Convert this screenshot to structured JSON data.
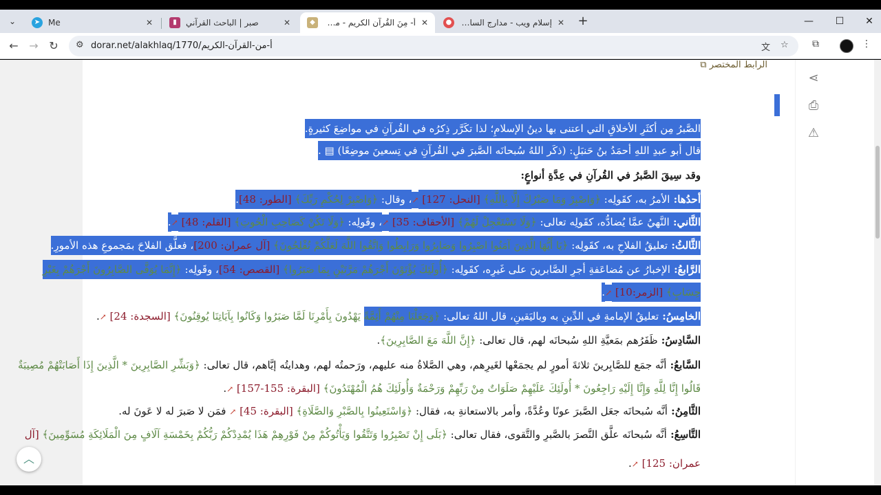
{
  "browser": {
    "tabs": [
      {
        "title": "Me",
        "active": false
      },
      {
        "title": "صبر | الباحث القرآني",
        "active": false
      },
      {
        "title": "أ- مِنَ القُرآنِ الكريمِ - موسوعة الأخلاق",
        "active": true
      },
      {
        "title": "إسلام ويب - مدارج السالكين بين",
        "active": false
      }
    ],
    "url": "dorar.net/alakhlaq/1770/أ-من-القرآن-الكريم",
    "colors": {
      "tabstrip": "#dfe3eb",
      "toolbar": "#ffffff",
      "selection": "#3b6fd8"
    }
  },
  "page": {
    "short_link": "الرابط المختصر",
    "lines": [
      {
        "sel": true,
        "segs": [
          {
            "t": "الصَّبرُ مِن أكثَرِ الأخلاقِ التي اعتنى بها دينُ الإسلامِ؛ لذا تكَرَّر ذِكرُه في القُرآنِ في مواضِعَ كثيرةٍ."
          }
        ]
      },
      {
        "sel": true,
        "segs": [
          {
            "t": "قال أبو عبدِ اللهِ أحمَدُ بنُ حَنبَلٍ: (ذكَر اللهُ سُبحانَه الصَّبرَ في القُرآنِ في تِسعينَ موضِعًا)"
          },
          {
            "t": " ▤ ."
          }
        ]
      },
      {
        "sel": false,
        "segs": [
          {
            "t": "وقد سِيقَ الصَّبرُ في القُرآنِ في عِدَّةِ أنواعٍ:",
            "c": "b"
          }
        ]
      },
      {
        "sel": true,
        "segs": [
          {
            "t": "أحدُها: ",
            "c": "b"
          },
          {
            "t": "الأمرُ به، كقَولِه: "
          },
          {
            "t": "﴿وَاصْبِرْ وَمَا صَبْرُكَ إِلَّا بِاللَّهِ﴾",
            "c": "q"
          },
          {
            "t": " [النحل: 127] ",
            "c": "ref"
          },
          {
            "t": "↗",
            "c": "ext"
          },
          {
            "t": "، وقال: "
          },
          {
            "t": "﴿وَاصْبِرْ لِحُكْمِ رَبِّكَ﴾",
            "c": "q"
          },
          {
            "t": " [الطور: 48]",
            "c": "ref"
          },
          {
            "t": "."
          }
        ]
      },
      {
        "sel": true,
        "segs": [
          {
            "t": "الثَّاني: ",
            "c": "b"
          },
          {
            "t": "النَّهيُ عمَّا يُضادُّه، كقَولِه تعالى: "
          },
          {
            "t": "﴿وَلَا تَسْتَعْجِلْ لَهُمْ﴾",
            "c": "q"
          },
          {
            "t": " [الأحقاف: 35] ",
            "c": "ref"
          },
          {
            "t": "↗",
            "c": "ext"
          },
          {
            "t": "، وقَولِه: "
          },
          {
            "t": "﴿وَلَا تَكُنْ كَصَاحِبِ الْحُوتِ﴾",
            "c": "q"
          },
          {
            "t": " [القلم: 48] ",
            "c": "ref"
          },
          {
            "t": "↗",
            "c": "ext"
          },
          {
            "t": "."
          }
        ]
      },
      {
        "sel": true,
        "segs": [
          {
            "t": "الثَّالثُ: ",
            "c": "b"
          },
          {
            "t": "تعليقُ الفلاحِ به، كقَولِه: "
          },
          {
            "t": "﴿يَا أَيُّهَا الَّذِينَ آمَنُوا اصْبِرُوا وَصَابِرُوا وَرَابِطُوا وَاتَّقُوا اللَّهَ لَعَلَّكُمْ تُفْلِحُونَ﴾",
            "c": "q"
          },
          {
            "t": " [آل عمران: 200]",
            "c": "ref"
          },
          {
            "t": "، فعلَّق الفلاحَ بمَجموعِ هذه الأمورِ."
          }
        ]
      },
      {
        "sel": true,
        "segs": [
          {
            "t": "الرَّابعُ: ",
            "c": "b"
          },
          {
            "t": "الإخبارُ عن مُضاعَفةِ أجرِ الصَّابرينَ على غَيرِه، كقَولِه: "
          },
          {
            "t": "﴿أُولَئِكَ يُؤْتَوْنَ أَجْرَهُمْ مَرَّتَيْنِ بِمَا صَبَرُوا﴾",
            "c": "q"
          },
          {
            "t": " [القصص: 54]",
            "c": "ref"
          },
          {
            "t": "، وقَولِه: "
          },
          {
            "t": "﴿إِنَّمَا يُوَفَّى الصَّابِرُونَ أَجْرَهُمْ بِغَيْرِ",
            "c": "q"
          }
        ]
      },
      {
        "sel": true,
        "segs": [
          {
            "t": "حِسَابٍ﴾",
            "c": "q"
          },
          {
            "t": " [الزمر:10] ",
            "c": "ref"
          },
          {
            "t": "↗",
            "c": "ext"
          },
          {
            "t": "."
          }
        ]
      },
      {
        "sel": false,
        "segs": [
          {
            "t": "الخامِسُ: ",
            "c": "b sel"
          },
          {
            "t": "تعليقُ الإمامةِ في الدِّينِ به وباليَقينِ، قال اللهُ تعالى: ",
            "c": "sel"
          },
          {
            "t": "﴿وَجَعَلْنَا مِنْهُمْ أَئِمَّةً",
            "c": "q sel"
          },
          {
            "t": " يَهْدُونَ بِأَمْرِنَا لَمَّا صَبَرُوا وَكَانُوا بِآيَاتِنَا يُوقِنُونَ﴾",
            "c": "q"
          },
          {
            "t": " [السجدة: 24] ",
            "c": "ref"
          },
          {
            "t": "↗",
            "c": "ext"
          },
          {
            "t": "."
          }
        ]
      },
      {
        "sel": false,
        "segs": [
          {
            "t": "السَّادِسُ: ",
            "c": "b"
          },
          {
            "t": "ظَفَرُهم بمَعيَّةِ اللهِ سُبحانَه لهم، قال تعالى: "
          },
          {
            "t": "﴿إِنَّ اللَّهَ مَعَ الصَّابِرِينَ﴾",
            "c": "q"
          },
          {
            "t": "."
          }
        ]
      },
      {
        "sel": false,
        "segs": [
          {
            "t": "السَّابعُ: ",
            "c": "b"
          },
          {
            "t": "أنَّه جمَع للصَّابِرينَ ثلاثةَ أمورٍ لم يجمَعْها لغَيرِهم، وهي الصَّلاةُ منه عليهم، ورَحمتُه لهم، وهدايتُه إيَّاهم، قال تعالى: "
          },
          {
            "t": "﴿وَبَشِّرِ الصَّابِرِينَ * الَّذِينَ إِذَا أَصَابَتْهُمْ مُصِيبَةٌ",
            "c": "q"
          }
        ]
      },
      {
        "sel": false,
        "segs": [
          {
            "t": "قَالُوا إِنَّا لِلَّهِ وَإِنَّا إِلَيْهِ رَاجِعُونَ * أُولَئِكَ عَلَيْهِمْ صَلَوَاتٌ مِنْ رَبِّهِمْ وَرَحْمَةٌ وَأُولَئِكَ هُمُ الْمُهْتَدُونَ﴾",
            "c": "q"
          },
          {
            "t": " [البقرة: 155-157] ",
            "c": "ref"
          },
          {
            "t": "↗",
            "c": "ext"
          },
          {
            "t": "."
          }
        ]
      },
      {
        "sel": false,
        "segs": [
          {
            "t": "الثَّامِنُ: ",
            "c": "b"
          },
          {
            "t": "أنَّه سُبحانَه جعَل الصَّبرَ عونًا وعُدَّةً، وأمر بالاستعانةِ به، فقال: "
          },
          {
            "t": "﴿وَاسْتَعِينُوا بِالصَّبْرِ وَالصَّلَاةِ﴾",
            "c": "q"
          },
          {
            "t": " [البقرة: 45] ",
            "c": "ref"
          },
          {
            "t": "↗",
            "c": "ext"
          },
          {
            "t": " فمَن لا صَبرَ له لا عَونَ له."
          }
        ]
      },
      {
        "sel": false,
        "segs": [
          {
            "t": "التَّاسِعُ: ",
            "c": "b"
          },
          {
            "t": "أنَّه سُبحانَه علَّق النَّصرَ بالصَّبرِ والتَّقوى، فقال تعالى: "
          },
          {
            "t": "﴿بَلَى إِنْ تَصْبِرُوا وَتَتَّقُوا وَيَأْتُوكُمْ مِنْ فَوْرِهِمْ هَذَا يُمْدِدْكُمْ رَبُّكُمْ بِخَمْسَةِ آلَافٍ مِنَ الْمَلَائِكَةِ مُسَوِّمِينَ﴾",
            "c": "q"
          },
          {
            "t": " [آل",
            "c": "ref"
          }
        ]
      },
      {
        "sel": false,
        "segs": [
          {
            "t": "عمران: 125] ",
            "c": "ref"
          },
          {
            "t": "↗",
            "c": "ext"
          },
          {
            "t": "."
          }
        ]
      }
    ]
  }
}
